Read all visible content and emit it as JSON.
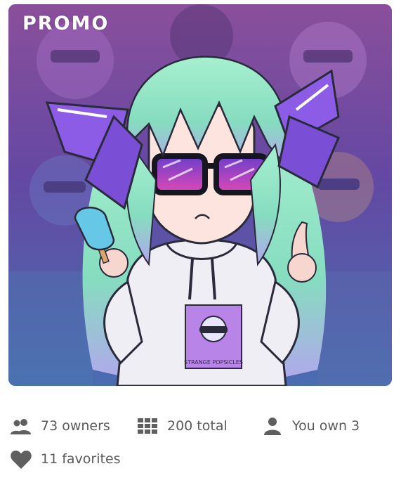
{
  "card": {
    "badge": "PROMO",
    "artwork_text": "STRANGE POPSICLES"
  },
  "stats": {
    "owners": "73 owners",
    "total": "200 total",
    "you_own": "You own 3",
    "favorites": "11 favorites"
  },
  "icons": {
    "owners": "people-icon",
    "total": "grid-icon",
    "you_own": "person-icon",
    "favorites": "heart-icon"
  },
  "colors": {
    "stat_text": "#5b5b5b",
    "icon": "#5f5f5f",
    "hair": "#8ee3c0",
    "bow": "#8a5ce6",
    "lens": "#c746c8"
  }
}
